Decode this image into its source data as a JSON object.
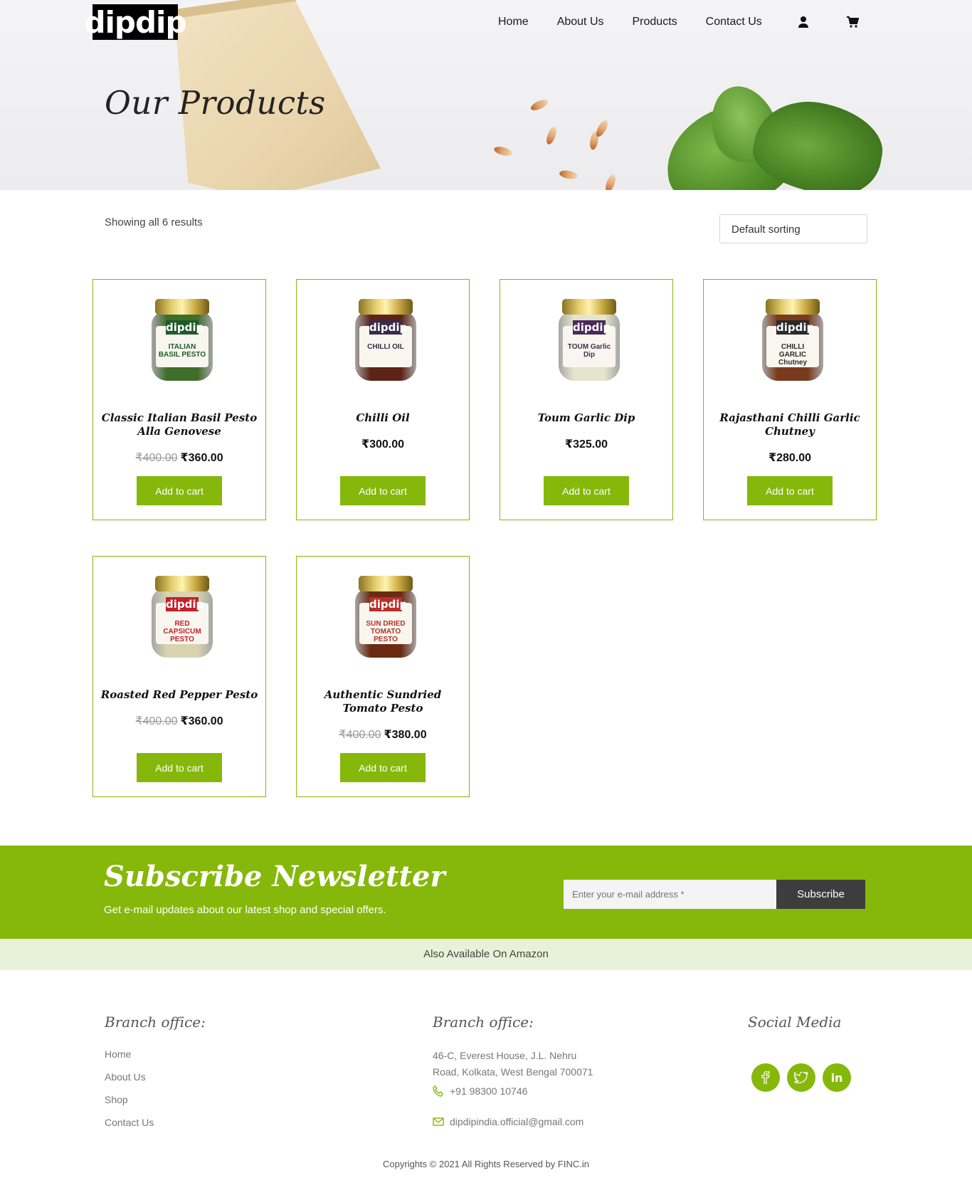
{
  "brand": {
    "logo_text": "dipdip"
  },
  "nav": {
    "items": [
      "Home",
      "About Us",
      "Products",
      "Contact Us"
    ],
    "account_icon": "user-icon",
    "cart_icon": "cart-icon"
  },
  "hero": {
    "title": "Our Products"
  },
  "shop": {
    "results_text": "Showing all 6 results",
    "sort_selected": "Default sorting"
  },
  "products": [
    {
      "name": "Classic Italian Basil Pesto Alla Genovese",
      "old_price": "₹400.00",
      "price": "₹360.00",
      "button": "Add to cart",
      "jar_label": "ITALIAN BASIL PESTO",
      "jar_color": "#3f6d2a",
      "band_color": "#1f5a2a"
    },
    {
      "name": "Chilli Oil",
      "old_price": "",
      "price": "₹300.00",
      "button": "Add to cart",
      "jar_label": "CHILLI OIL",
      "jar_color": "#5b2416",
      "band_color": "#3a2a4a"
    },
    {
      "name": "Toum Garlic Dip",
      "old_price": "",
      "price": "₹325.00",
      "button": "Add to cart",
      "jar_label": "TOUM Garlic Dip",
      "jar_color": "#e6e4cc",
      "band_color": "#4a2a5a"
    },
    {
      "name": "Rajasthani Chilli Garlic Chutney",
      "old_price": "",
      "price": "₹280.00",
      "button": "Add to cart",
      "jar_label": "CHILLI GARLIC Chutney",
      "jar_color": "#7a3a1e",
      "band_color": "#2a2a2a"
    },
    {
      "name": "Roasted Red Pepper Pesto",
      "old_price": "₹400.00",
      "price": "₹360.00",
      "button": "Add to cart",
      "jar_label": "RED CAPSICUM PESTO",
      "jar_color": "#d9d3b0",
      "band_color": "#c4202c"
    },
    {
      "name": "Authentic Sundried Tomato Pesto",
      "old_price": "₹400.00",
      "price": "₹380.00",
      "button": "Add to cart",
      "jar_label": "SUN DRIED TOMATO PESTO",
      "jar_color": "#6b2a12",
      "band_color": "#b7302a"
    }
  ],
  "newsletter": {
    "title": "Subscribe Newsletter",
    "subtitle": "Get e-mail updates about our latest shop and special offers.",
    "placeholder": "Enter your e-mail address *",
    "button": "Subscribe"
  },
  "amazon": {
    "text": "Also Available On Amazon"
  },
  "footer": {
    "col1_title": "Branch office:",
    "links": [
      "Home",
      "About Us",
      "Shop",
      "Contact Us"
    ],
    "col2_title": "Branch office:",
    "address": "46-C, Everest House, J.L. Nehru Road, Kolkata, West Bengal 700071",
    "phone": "+91 98300 10746",
    "email": "dipdipindia.official@gmail.com",
    "col3_title": "Social Media",
    "social": [
      "facebook-icon",
      "twitter-icon",
      "linkedin-icon"
    ],
    "copyright": "Copyrights © 2021 All Rights Reserved by FINC.in"
  },
  "colors": {
    "accent": "#85b80a",
    "dark": "#3d3d3d",
    "amazon_bg": "#e8f2d8"
  }
}
